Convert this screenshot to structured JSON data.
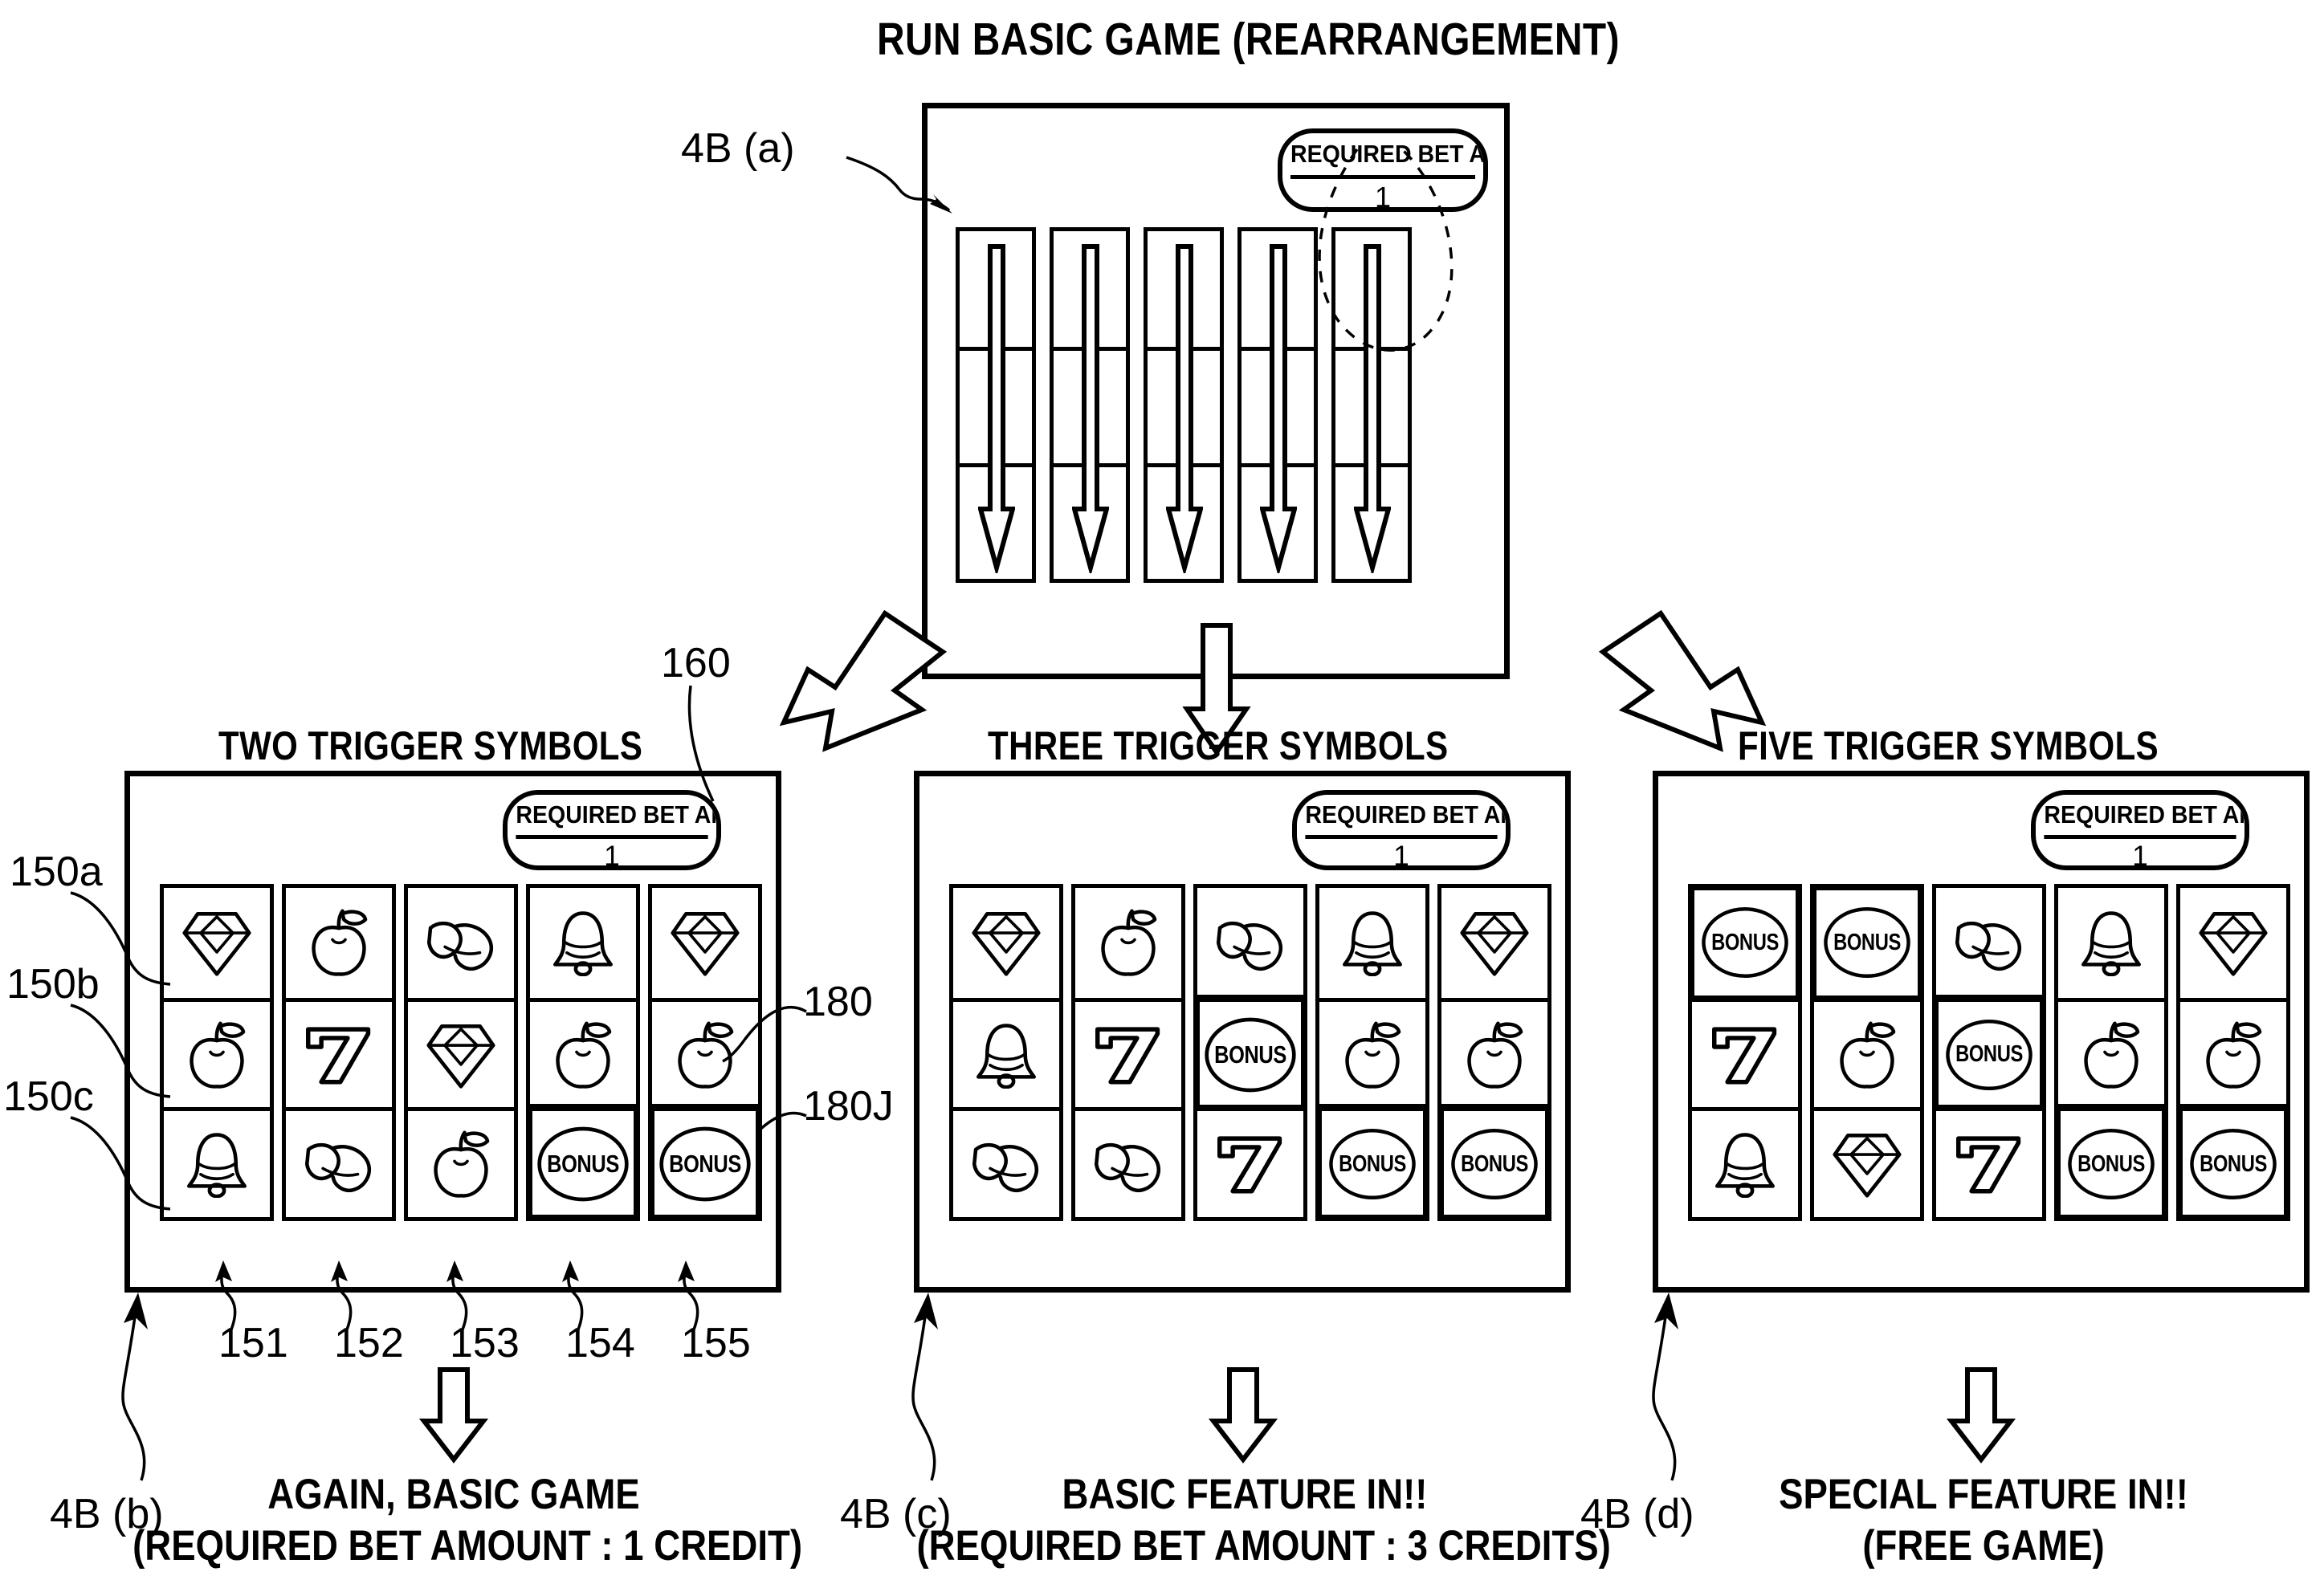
{
  "figure": {
    "top_title": "RUN BASIC GAME (REARRANGEMENT)",
    "bet_badge": {
      "label": "REQUIRED BET AMOUNT",
      "value": "1"
    },
    "bonus_label": "BONUS"
  },
  "panels": {
    "a": {
      "ref": "4B (a)",
      "title": "RUN BASIC GAME (REARRANGEMENT)",
      "bet": {
        "label": "REQUIRED BET AMOUNT",
        "value": "1"
      },
      "reels": 5,
      "rows": 3,
      "state": "spinning"
    },
    "b": {
      "ref": "4B (b)",
      "heading": "TWO TRIGGER SYMBOLS",
      "bet": {
        "label": "REQUIRED BET AMOUNT",
        "value": "1"
      },
      "grid": [
        [
          "diamond",
          "apple",
          "banana",
          "bell",
          "diamond"
        ],
        [
          "apple",
          "seven",
          "diamond",
          "apple",
          "apple"
        ],
        [
          "bell",
          "banana",
          "apple",
          "bonus",
          "bonus"
        ]
      ],
      "highlighted": [
        [
          2,
          3
        ],
        [
          2,
          4
        ]
      ],
      "caption_line1": "AGAIN, BASIC GAME",
      "caption_line2": "(REQUIRED BET AMOUNT : 1 CREDIT)"
    },
    "c": {
      "ref": "4B (c)",
      "heading": "THREE TRIGGER SYMBOLS",
      "bet": {
        "label": "REQUIRED BET AMOUNT",
        "value": "1"
      },
      "grid": [
        [
          "diamond",
          "apple",
          "banana",
          "bell",
          "diamond"
        ],
        [
          "bell",
          "seven",
          "bonus",
          "apple",
          "apple"
        ],
        [
          "banana",
          "banana",
          "seven",
          "bonus",
          "bonus"
        ]
      ],
      "highlighted": [
        [
          1,
          2
        ],
        [
          2,
          3
        ],
        [
          2,
          4
        ]
      ],
      "caption_line1": "BASIC FEATURE IN!!",
      "caption_line2": "(REQUIRED BET AMOUNT : 3 CREDITS)"
    },
    "d": {
      "ref": "4B (d)",
      "heading": "FIVE TRIGGER SYMBOLS",
      "bet": {
        "label": "REQUIRED BET AMOUNT",
        "value": "1"
      },
      "grid": [
        [
          "bonus",
          "bonus",
          "banana",
          "bell",
          "diamond"
        ],
        [
          "seven",
          "apple",
          "bonus",
          "apple",
          "apple"
        ],
        [
          "bell",
          "diamond",
          "seven",
          "bonus",
          "bonus"
        ]
      ],
      "highlighted": [
        [
          0,
          0
        ],
        [
          0,
          1
        ],
        [
          1,
          2
        ],
        [
          2,
          3
        ],
        [
          2,
          4
        ]
      ],
      "caption_line1": "SPECIAL FEATURE IN!!",
      "caption_line2": "(FREE GAME)"
    }
  },
  "reference_numerals": {
    "badge_160": "160",
    "row_150a": "150a",
    "row_150b": "150b",
    "row_150c": "150c",
    "cell_180": "180",
    "cell_180J": "180J",
    "reel_151": "151",
    "reel_152": "152",
    "reel_153": "153",
    "reel_154": "154",
    "reel_155": "155"
  }
}
